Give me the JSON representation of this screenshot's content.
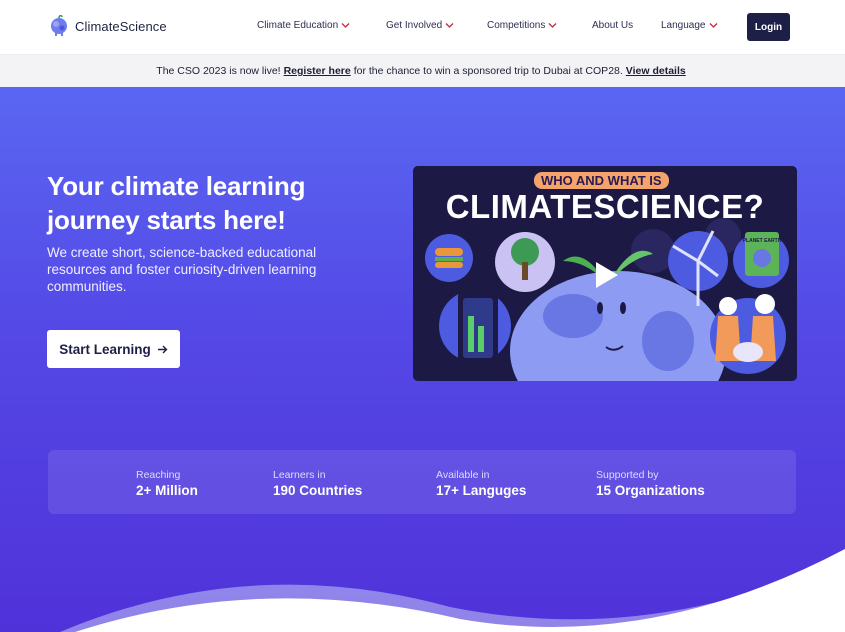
{
  "brand": {
    "name": "ClimateScience"
  },
  "nav": {
    "items": [
      {
        "label": "Climate Education",
        "has_dropdown": true
      },
      {
        "label": "Get Involved",
        "has_dropdown": true
      },
      {
        "label": "Competitions",
        "has_dropdown": true
      },
      {
        "label": "About Us",
        "has_dropdown": false
      },
      {
        "label": "Language",
        "has_dropdown": true
      }
    ],
    "login_label": "Login"
  },
  "banner": {
    "text_before": "The CSO 2023 is now live!",
    "link1": "Register here",
    "text_middle": "for the chance to win a sponsored trip to Dubai at COP28.",
    "link2": "View details"
  },
  "hero": {
    "title": "Your climate learning journey starts here!",
    "subtitle": "We create short, science-backed educational resources and foster curiosity-driven learning communities.",
    "cta_label": "Start Learning"
  },
  "video": {
    "tag": "WHO AND WHAT IS",
    "headline": "CLIMATESCIENCE?",
    "book_text": "PLANET EARTH"
  },
  "stats": [
    {
      "label": "Reaching",
      "value": "2+ Million"
    },
    {
      "label": "Learners in",
      "value": "190 Countries"
    },
    {
      "label": "Available in",
      "value": "17+ Languges"
    },
    {
      "label": "Supported by",
      "value": "15 Organizations"
    }
  ],
  "colors": {
    "hero_top": "#5a67f2",
    "hero_bottom": "#5032d9",
    "login_bg": "#1e1f47",
    "dropdown_chevron": "#c0283a",
    "video_tag_bg": "#f4a36b"
  }
}
